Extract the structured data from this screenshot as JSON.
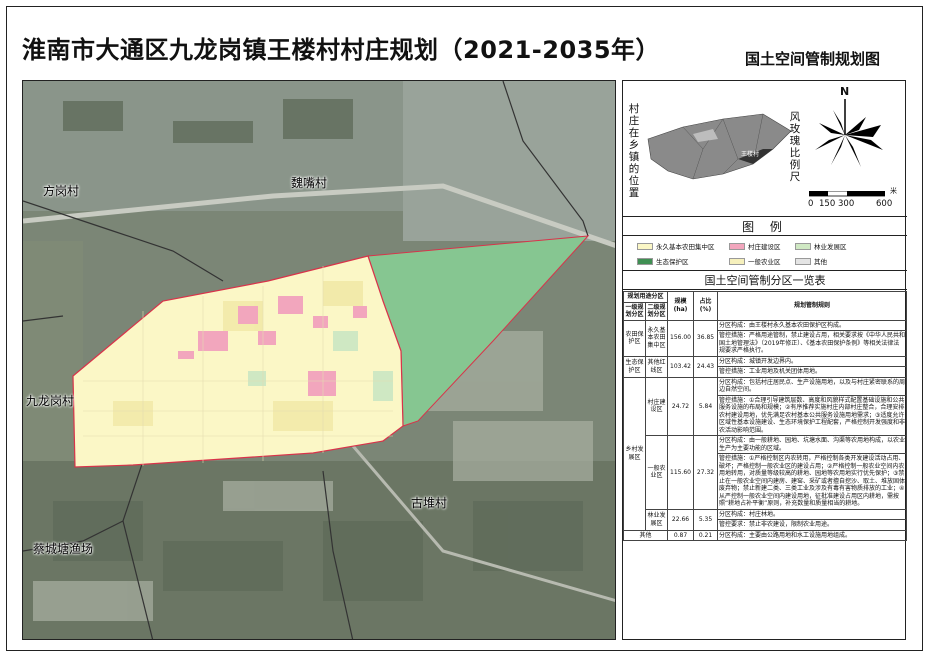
{
  "title": "淮南市大通区九龙岗镇王楼村村庄规划（2021-2035年）",
  "subtitle": "国土空间管制规划图",
  "map_labels": {
    "weizui": "魏嘴村",
    "fanggang": "方岗村",
    "jiulonggang": "九龙岗村",
    "gudui": "古堆村",
    "caicheng": "蔡城塘渔场"
  },
  "colors": {
    "farmland": "#fbf7c6",
    "village": "#f2a6bd",
    "forest": "#cfe8c3",
    "eco": "#86c691",
    "agri": "#f6f0bc",
    "other": "#e4e4e4",
    "boundary": "#d9334a"
  },
  "location": {
    "label_left": "村庄在乡镇的位置",
    "label_right": "风玫瑰比例尺",
    "village_tag": "王楼村",
    "north": "N",
    "scale_unit": "米",
    "scale_ticks": [
      "0",
      "150",
      "300",
      "600"
    ]
  },
  "legend": {
    "title": "图  例",
    "items": [
      {
        "label": "永久基本农田集中区",
        "color": "#fbf7c6"
      },
      {
        "label": "村庄建设区",
        "color": "#f2a6bd"
      },
      {
        "label": "林业发展区",
        "color": "#cfe8c3"
      },
      {
        "label": "生态保护区",
        "color": "#3f8f53"
      },
      {
        "label": "一般农业区",
        "color": "#f6f0bc"
      },
      {
        "label": "其他",
        "color": "#e4e4e4"
      }
    ]
  },
  "table": {
    "title": "国土空间管制分区一览表",
    "header_group": "规划用途分区",
    "headers": [
      "一级规划分区",
      "二级规划分区",
      "规模(ha)",
      "占比(%)",
      "规划管制规则"
    ],
    "rows": {
      "farm_l1": "农田保护区",
      "farm_l2": "永久基本农田集中区",
      "farm_area": "156.00",
      "farm_pct": "36.85",
      "farm_rule1": "分区构成：由王楼村永久基本农田保护区构成。",
      "farm_rule2": "管控措施：严格用途管制，禁止建设占用，相关要求按《中华人民共和国土地管理法》（2019年修正）、《基本农田保护条例》等相关法律法规要求严格执行。",
      "eco_l1": "生态保护区",
      "eco_l2": "其他红线区",
      "eco_area": "103.42",
      "eco_pct": "24.43",
      "eco_rule1": "分区构成：城镇开发边界内。",
      "eco_rule2": "管控措施：工业用地及机关团体用地。",
      "rural_l1": "乡村发展区",
      "vil_l2": "村庄建设区",
      "vil_area": "24.72",
      "vil_pct": "5.84",
      "vil_rule1": "分区构成：包括村庄居民点、生产设施用地，以及与村庄紧密联系的周边自然空间。",
      "vil_rule2": "管控措施：①合理引导建筑层数、高度和风貌样式配置基础设施和公共服务设施的布局和规模；②有序推荐实施村庄内部村庄整合，合理安排农村建设用地，优先满足农村基本公共服务设施用地需求；③适度允许区域性基本设施建设、生态环境保护工程配套，严格控制开发强度和非农活动影响范围。",
      "agri_l2": "一般农业区",
      "agri_area": "115.60",
      "agri_pct": "27.32",
      "agri_rule1": "分区构成：由一般耕地、园地、坑塘水面、沟渠等农用地构成，以农业生产为主要功能的区域。",
      "agri_rule2": "管控措施：①严格控制区内农转用，严格控制各类开发建设活动占用、破坏；严格控制一般农业区的建设占用；②严格控制一般农业空间内农用地转用，对质量等级较高的耕地、园地等农用地实行优先保护；③禁止在一般农业空间内建房、建窑、采矿或者擅自挖沙、取土、堆放固体废弃物；禁止新建二类、三类工业及涉及有毒有害物质排放的工业；④从严控制一般农业空间内建设用地，征批准建设占用区内耕地，需按照“耕地占补平衡”原则，补充数量和质量相当的耕地。",
      "forest_l2": "林业发展区",
      "forest_area": "22.66",
      "forest_pct": "5.35",
      "forest_rule1": "分区构成：村庄林地。",
      "forest_rule2": "管控要求：禁止非农建设，限制农业用途。",
      "other_l1": "其他",
      "other_area": "0.87",
      "other_pct": "0.21",
      "other_rule": "分区构成：主要由公路用地和水工设施用地组成。"
    }
  }
}
